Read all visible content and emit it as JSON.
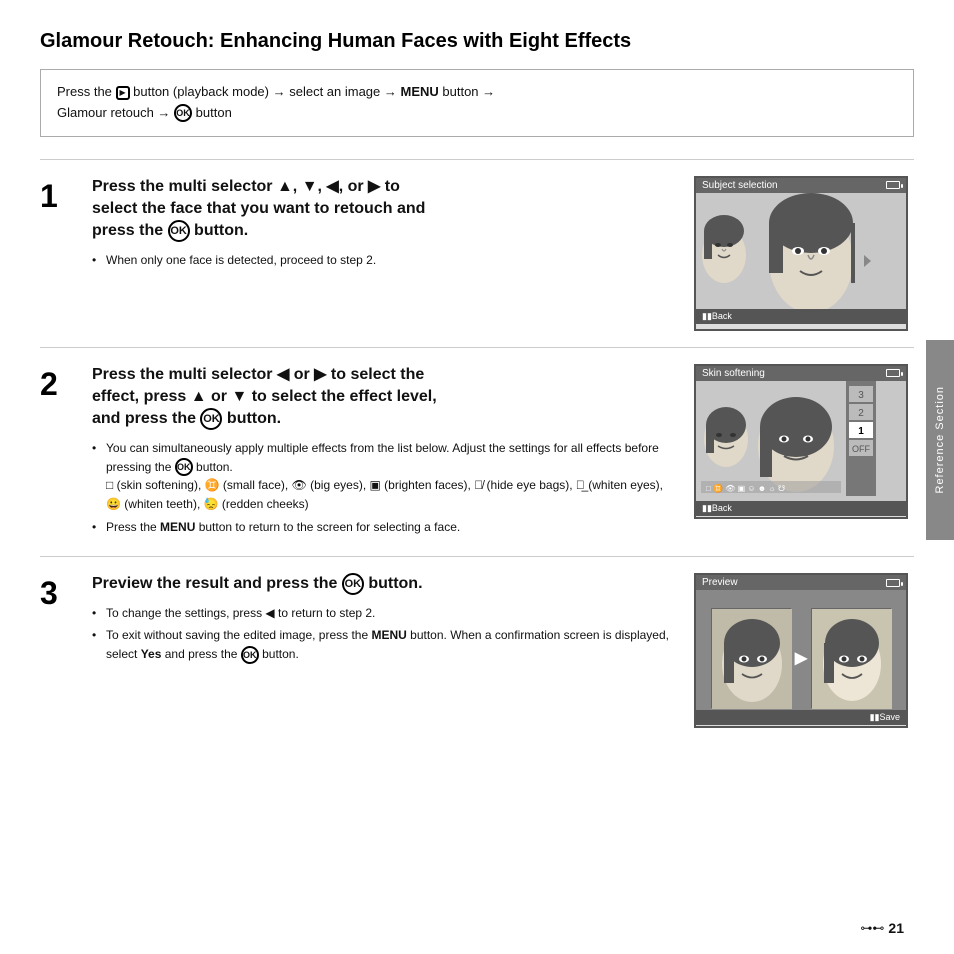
{
  "page": {
    "title": "Glamour Retouch: Enhancing Human Faces with Eight Effects",
    "page_number": "21"
  },
  "instruction_box": {
    "text": "Press the [playback] button (playback mode) → select an image → MENU button → Glamour retouch → [OK] button"
  },
  "steps": [
    {
      "number": "1",
      "title": "Press the multi selector ▲, ▼, ◀, or ▶ to select the face that you want to retouch and press the [OK] button.",
      "bullets": [
        "When only one face is detected, proceed to step 2."
      ],
      "screen_title": "Subject selection",
      "screen_bottom": "Back"
    },
    {
      "number": "2",
      "title": "Press the multi selector ◀ or ▶ to select the effect, press ▲ or ▼ to select the effect level, and press the [OK] button.",
      "bullets": [
        "You can simultaneously apply multiple effects from the list below. Adjust the settings for all effects before pressing the [OK] button.",
        "[skin softening], [small face], [big eyes], [brighten faces], [hide eye bags], [whiten eyes], [whiten teeth], [redden cheeks]",
        "Press the MENU button to return to the screen for selecting a face."
      ],
      "screen_title": "Skin softening",
      "screen_bottom": "Back",
      "levels": [
        "3",
        "2",
        "1",
        "OFF"
      ]
    },
    {
      "number": "3",
      "title": "Preview the result and press the [OK] button.",
      "bullets": [
        "To change the settings, press ◀ to return to step 2.",
        "To exit without saving the edited image, press the MENU button. When a confirmation screen is displayed, select Yes and press the [OK] button."
      ],
      "screen_title": "Preview",
      "screen_bottom": "Save"
    }
  ],
  "side_tab": {
    "label": "Reference Section"
  },
  "footer": {
    "icon": "🔌",
    "page": "21"
  }
}
